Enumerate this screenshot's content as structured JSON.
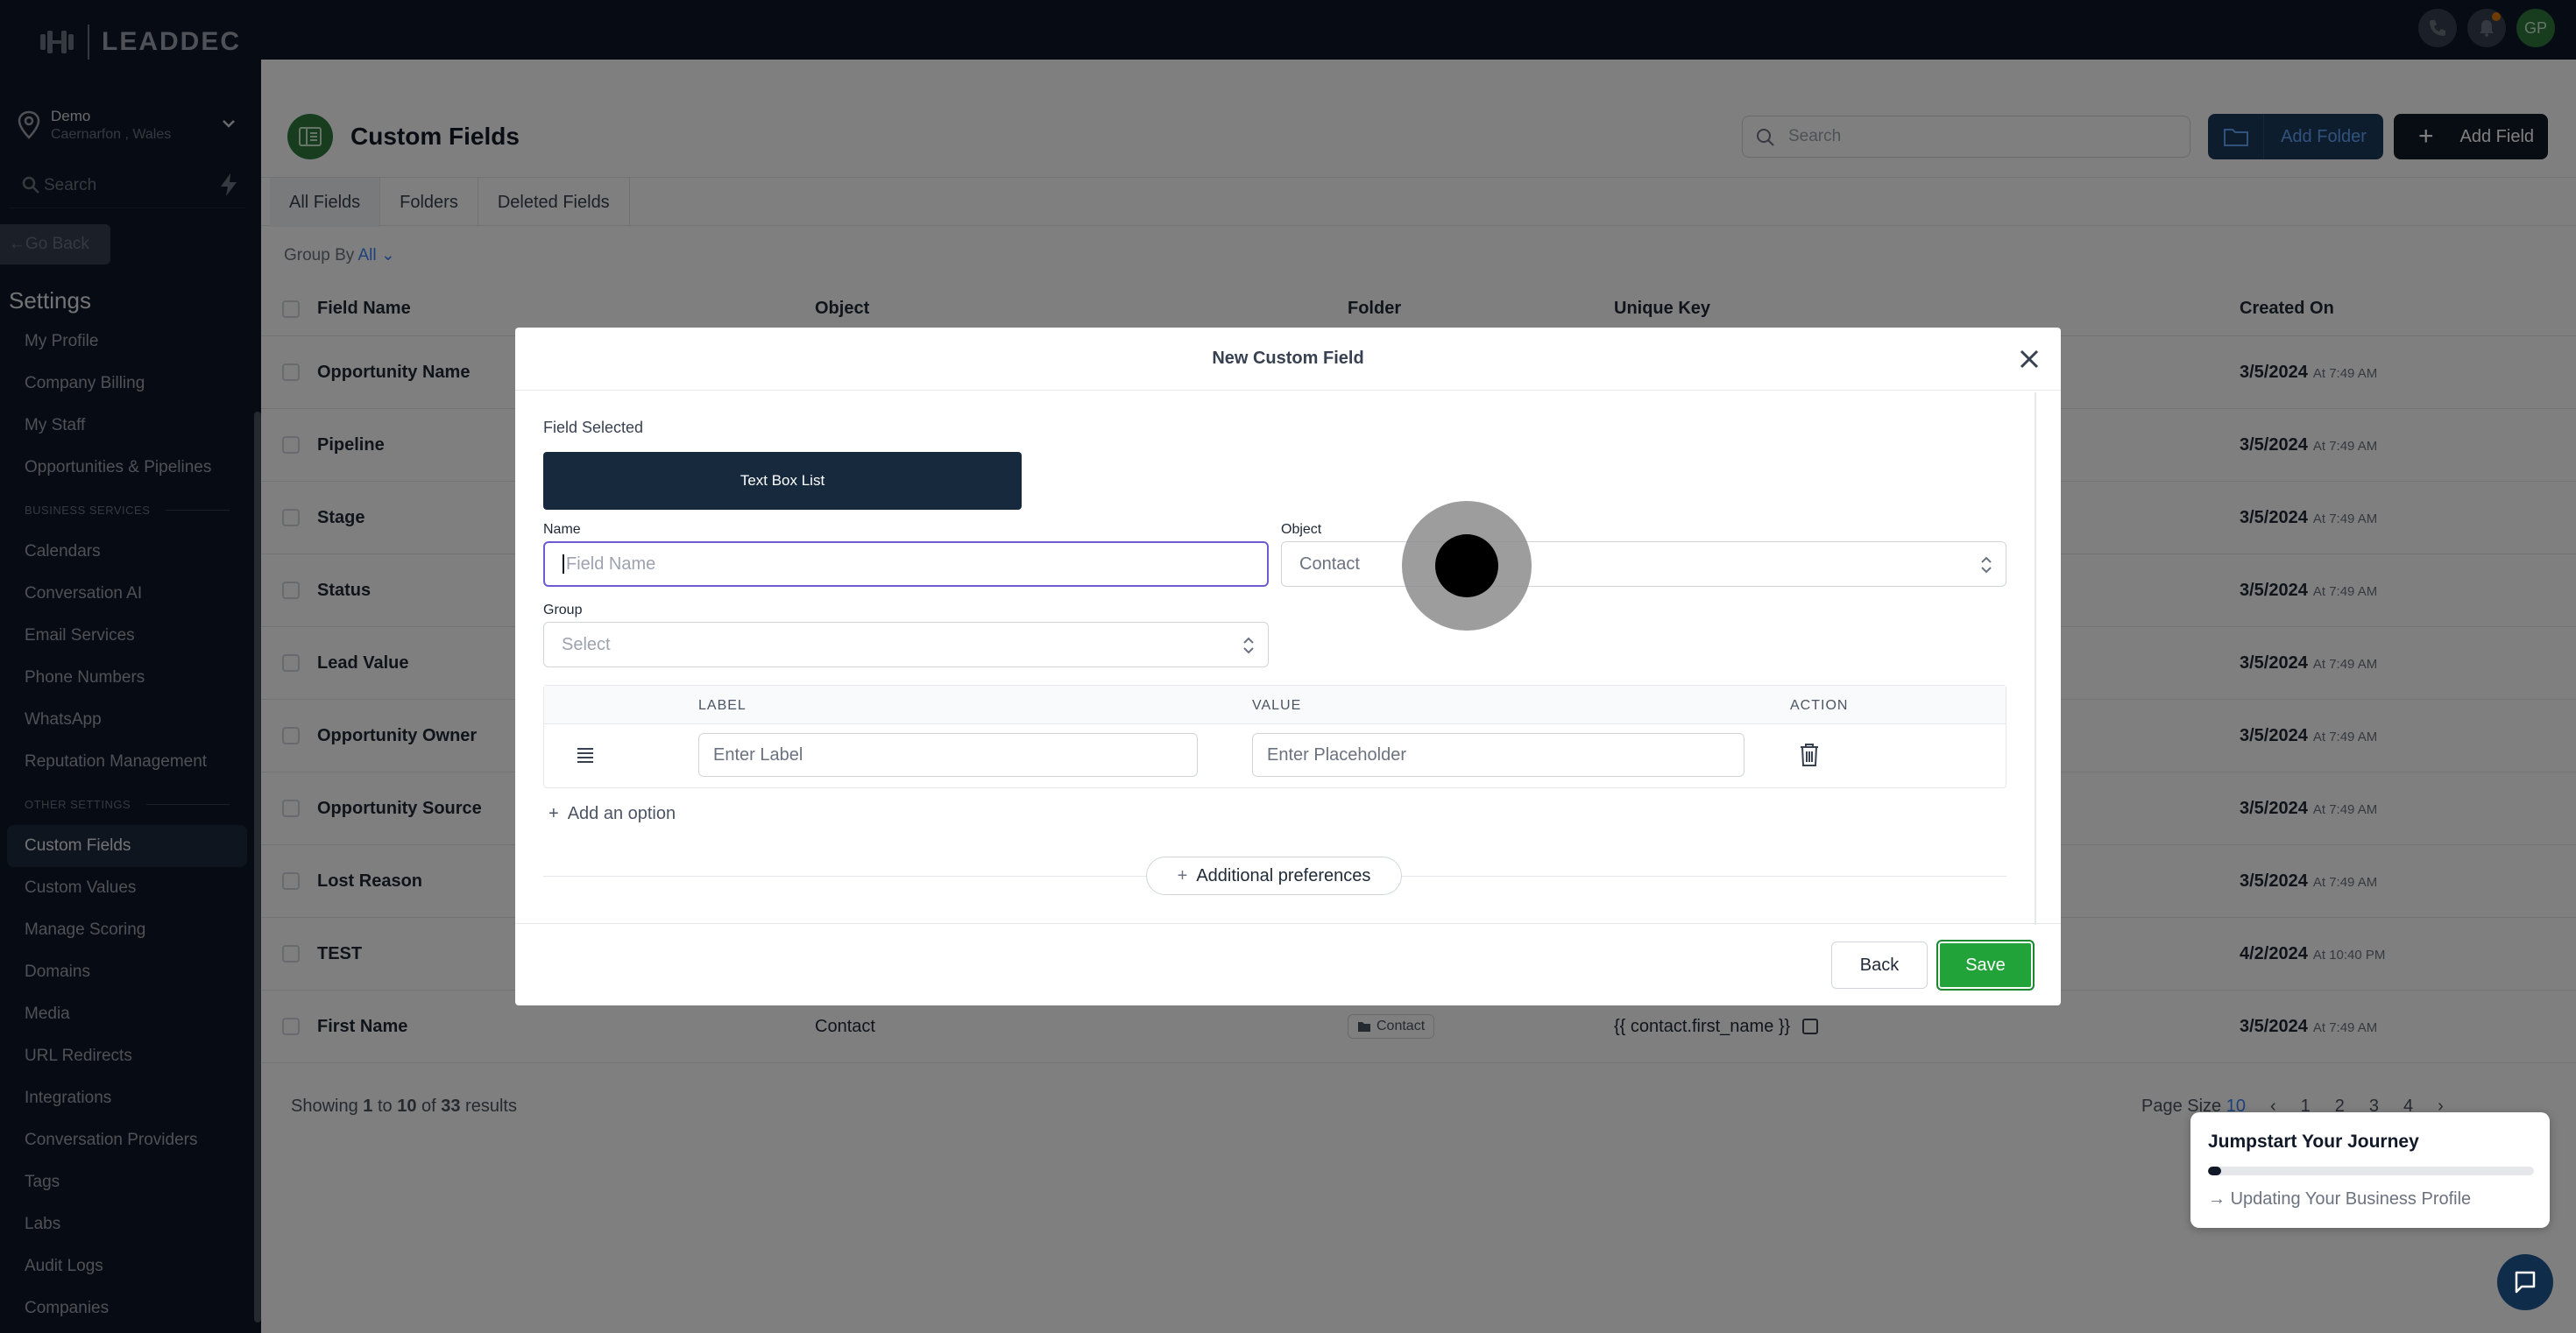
{
  "brand": {
    "name": "LEADDEC"
  },
  "location": {
    "name": "Demo",
    "sub": "Caernarfon , Wales"
  },
  "sidebar": {
    "search_placeholder": "Search",
    "go_back": "Go Back",
    "settings_title": "Settings",
    "items": [
      {
        "label": "My Profile"
      },
      {
        "label": "Company Billing"
      },
      {
        "label": "My Staff"
      },
      {
        "label": "Opportunities & Pipelines"
      }
    ],
    "section_business": "BUSINESS SERVICES",
    "business_items": [
      {
        "label": "Calendars"
      },
      {
        "label": "Conversation AI"
      },
      {
        "label": "Email Services"
      },
      {
        "label": "Phone Numbers"
      },
      {
        "label": "WhatsApp"
      },
      {
        "label": "Reputation Management"
      }
    ],
    "section_other": "OTHER SETTINGS",
    "other_items": [
      {
        "label": "Custom Fields"
      },
      {
        "label": "Custom Values"
      },
      {
        "label": "Manage Scoring"
      },
      {
        "label": "Domains"
      },
      {
        "label": "Media"
      },
      {
        "label": "URL Redirects"
      },
      {
        "label": "Integrations"
      },
      {
        "label": "Conversation Providers"
      },
      {
        "label": "Tags"
      },
      {
        "label": "Labs"
      },
      {
        "label": "Audit Logs"
      },
      {
        "label": "Companies"
      }
    ]
  },
  "topbar": {
    "avatar_initials": "GP"
  },
  "page": {
    "title": "Custom Fields",
    "search_placeholder": "Search",
    "add_folder": "Add Folder",
    "add_field": "Add Field",
    "tabs": [
      {
        "label": "All Fields"
      },
      {
        "label": "Folders"
      },
      {
        "label": "Deleted Fields"
      }
    ],
    "group_by_label": "Group By",
    "group_by_value": "All",
    "columns": {
      "name": "Field Name",
      "object": "Object",
      "folder": "Folder",
      "key": "Unique Key",
      "created": "Created On"
    },
    "rows": [
      {
        "name": "Opportunity Name",
        "date": "3/5/2024",
        "time": "At 7:49 AM"
      },
      {
        "name": "Pipeline",
        "date": "3/5/2024",
        "time": "At 7:49 AM"
      },
      {
        "name": "Stage",
        "date": "3/5/2024",
        "time": "At 7:49 AM"
      },
      {
        "name": "Status",
        "date": "3/5/2024",
        "time": "At 7:49 AM"
      },
      {
        "name": "Lead Value",
        "date": "3/5/2024",
        "time": "At 7:49 AM"
      },
      {
        "name": "Opportunity Owner",
        "date": "3/5/2024",
        "time": "At 7:49 AM"
      },
      {
        "name": "Opportunity Source",
        "date": "3/5/2024",
        "time": "At 7:49 AM"
      },
      {
        "name": "Lost Reason",
        "date": "3/5/2024",
        "time": "At 7:49 AM"
      },
      {
        "name": "TEST",
        "date": "4/2/2024",
        "time": "At 10:40 PM"
      },
      {
        "name": "First Name",
        "object": "Contact",
        "folder": "Contact",
        "key": "{{ contact.first_name }}",
        "date": "3/5/2024",
        "time": "At 7:49 AM"
      }
    ],
    "showing_prefix": "Showing ",
    "showing_from": "1",
    "showing_mid1": " to ",
    "showing_to": "10",
    "showing_mid2": " of ",
    "showing_total": "33",
    "showing_suffix": " results",
    "pager": {
      "page_size_label": "Page Size",
      "page_size_value": "10",
      "pages": [
        "1",
        "2",
        "3",
        "4"
      ]
    }
  },
  "modal": {
    "title": "New Custom Field",
    "field_selected_label": "Field Selected",
    "field_type": "Text Box List",
    "name_label": "Name",
    "name_placeholder": "Field Name",
    "object_label": "Object",
    "object_value": "Contact",
    "group_label": "Group",
    "group_placeholder": "Select",
    "options_columns": {
      "label": "LABEL",
      "value": "VALUE",
      "action": "ACTION"
    },
    "option_label_placeholder": "Enter Label",
    "option_value_placeholder": "Enter Placeholder",
    "add_option": "Add an option",
    "additional_preferences": "Additional preferences",
    "back": "Back",
    "save": "Save"
  },
  "jumpstart": {
    "title": "Jumpstart Your Journey",
    "step": "Updating Your Business Profile",
    "progress": 0.04
  },
  "colors": {
    "accent_green": "#22a33a",
    "sidebar_bg": "#0f1929",
    "focus_purple": "#6d5bd0"
  }
}
